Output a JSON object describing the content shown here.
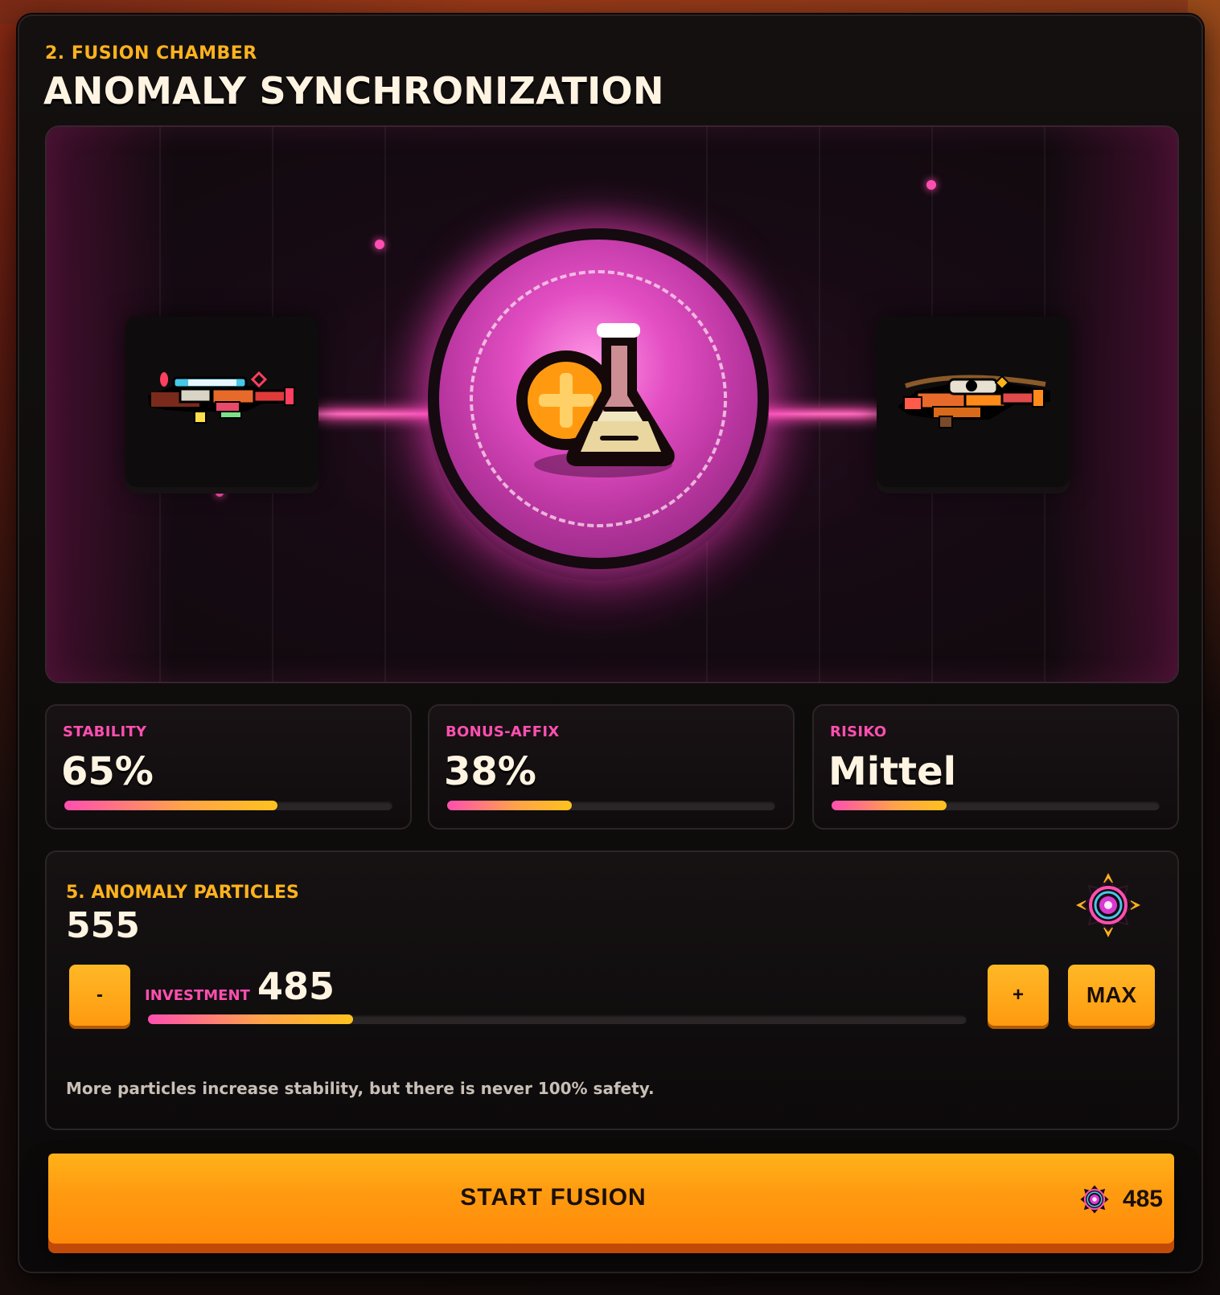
{
  "header": {
    "eyebrow": "2. FUSION CHAMBER",
    "title": "ANOMALY SYNCHRONIZATION"
  },
  "chamber": {
    "left_item_icon": "blaster-weapon-icon",
    "center_icon": "flask-plus-icon",
    "right_item_icon": "rifle-weapon-icon"
  },
  "stats": [
    {
      "label": "STABILITY",
      "value": "65%",
      "fill": 0.65
    },
    {
      "label": "BONUS-AFFIX",
      "value": "38%",
      "fill": 0.38
    },
    {
      "label": "RISIKO",
      "value": "Mittel",
      "fill": 0.35
    }
  ],
  "particles": {
    "label": "5. ANOMALY PARTICLES",
    "count": "555",
    "icon": "anomaly-particle-icon",
    "minus_label": "-",
    "plus_label": "+",
    "max_label": "MAX",
    "investment_label": "INVESTMENT",
    "investment_value": "485",
    "investment_fill": 0.25,
    "hint": "More particles increase stability, but there is never 100% safety."
  },
  "start": {
    "label": "START FUSION",
    "cost": "485"
  },
  "colors": {
    "accent_yellow": "#ffb21e",
    "accent_pink": "#ff4fb0",
    "button_orange": "#ff9a10"
  }
}
